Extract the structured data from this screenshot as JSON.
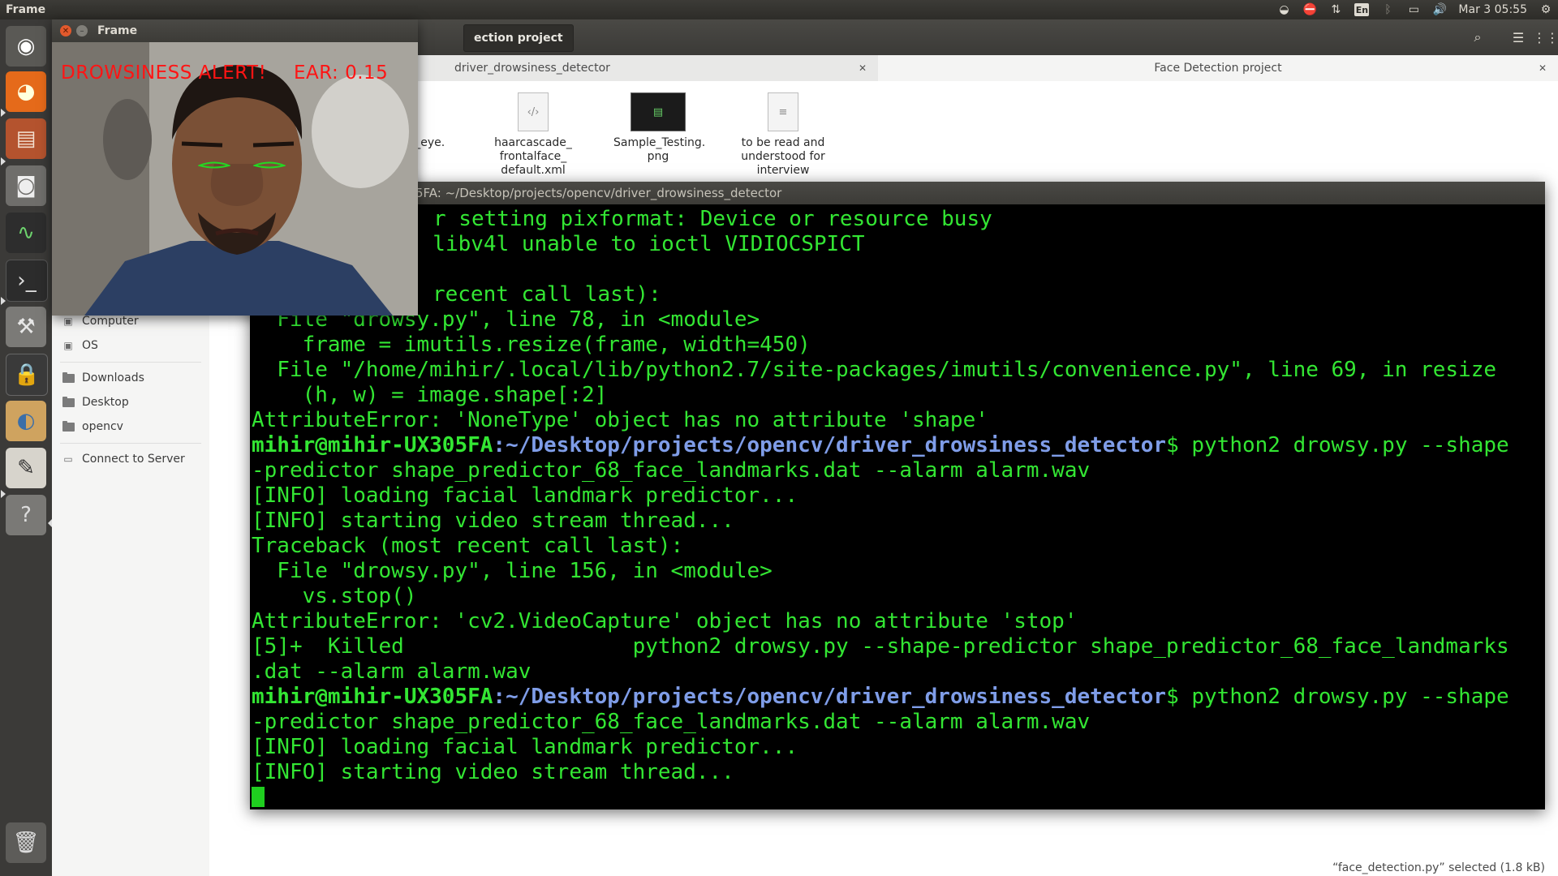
{
  "top_panel": {
    "app_title": "Frame",
    "keyboard_layout": "En",
    "clock": "Mar 3 05:55"
  },
  "launcher": {
    "items": [
      "dash-home",
      "firefox",
      "files",
      "screenshot",
      "system-monitor",
      "terminal",
      "system-settings",
      "lock-screen",
      "photo-viewer",
      "text-editor",
      "help",
      "trash"
    ]
  },
  "file_manager": {
    "breadcrumb": "ection project",
    "tabs": [
      {
        "label": "driver_drowsiness_detector"
      },
      {
        "label": "Face Detection project"
      }
    ],
    "sidebar": [
      {
        "label": "Computer"
      },
      {
        "label": "OS"
      },
      {
        "label": "Downloads"
      },
      {
        "label": "Desktop"
      },
      {
        "label": "opencv"
      },
      {
        "label": "Connect to Server"
      }
    ],
    "files": [
      {
        "name": "de_eye."
      },
      {
        "name": "haarcascade_ frontalface_ default.xml"
      },
      {
        "name": "Sample_Testing. png"
      },
      {
        "name": "to be read and understood for interview"
      }
    ],
    "status": "“face_detection.py” selected  (1.8 kB)"
  },
  "terminal": {
    "title": "5FA: ~/Desktop/projects/opencv/driver_drowsiness_detector",
    "prompt_user": "mihir@mihir-UX305FA",
    "prompt_path": ":~/Desktop/projects/opencv/driver_drowsiness_detector",
    "lines": {
      "l1": "r setting pixformat: Device or resource busy",
      "l2": ": libv4l unable to ioctl VIDIOCSPICT",
      "l3": "",
      "l4": "st recent call last):",
      "l5": "  File \"drowsy.py\", line 78, in <module>",
      "l6": "    frame = imutils.resize(frame, width=450)",
      "l7": "  File \"/home/mihir/.local/lib/python2.7/site-packages/imutils/convenience.py\", line 69, in resize",
      "l8": "    (h, w) = image.shape[:2]",
      "l9": "AttributeError: 'NoneType' object has no attribute 'shape'",
      "l10_cmd": "$ python2 drowsy.py --shape",
      "l11": "-predictor shape_predictor_68_face_landmarks.dat --alarm alarm.wav",
      "l12": "[INFO] loading facial landmark predictor...",
      "l13": "[INFO] starting video stream thread...",
      "l14": "Traceback (most recent call last):",
      "l15": "  File \"drowsy.py\", line 156, in <module>",
      "l16": "    vs.stop()",
      "l17": "AttributeError: 'cv2.VideoCapture' object has no attribute 'stop'",
      "l18": "[5]+  Killed                  python2 drowsy.py --shape-predictor shape_predictor_68_face_landmarks",
      "l19": ".dat --alarm alarm.wav",
      "l20_cmd": "$ python2 drowsy.py --shape",
      "l21": "-predictor shape_predictor_68_face_landmarks.dat --alarm alarm.wav",
      "l22": "[INFO] loading facial landmark predictor...",
      "l23": "[INFO] starting video stream thread..."
    }
  },
  "frame_window": {
    "title": "Frame",
    "alert_text": "DROWSINESS ALERT!",
    "ear_text": "EAR: 0.15",
    "alert_color": "#ff1414"
  }
}
